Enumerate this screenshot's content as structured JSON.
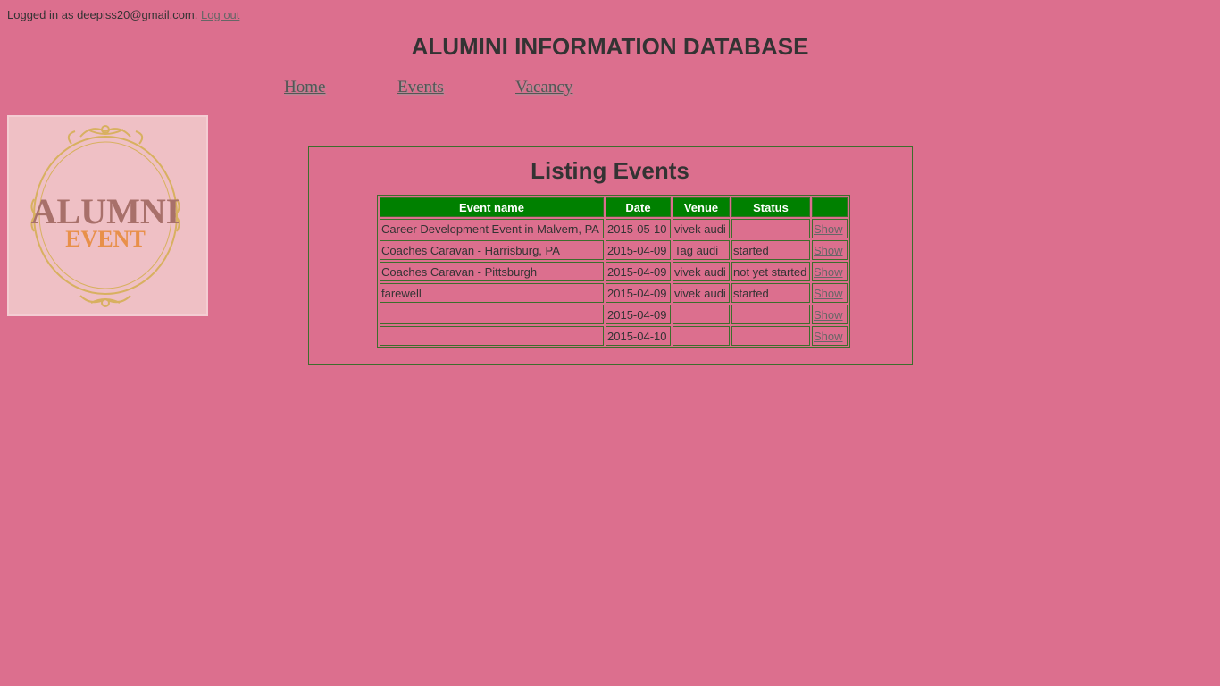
{
  "header": {
    "logged_in_text": "Logged in as deepiss20@gmail.com.",
    "logout_label": "Log out",
    "site_title": "ALUMINI INFORMATION DATABASE"
  },
  "nav": {
    "home": "Home",
    "events": "Events",
    "vacancy": "Vacancy"
  },
  "logo": {
    "line1": "ALUMNI",
    "line2": "EVENT",
    "colors": {
      "line1": "#a8706a",
      "line2": "#e8904a",
      "ornament": "#d8b060"
    }
  },
  "main": {
    "title": "Listing Events",
    "columns": [
      "Event name",
      "Date",
      "Venue",
      "Status",
      ""
    ],
    "rows": [
      {
        "name": "Career Development Event in Malvern, PA",
        "date": "2015-05-10",
        "venue": "vivek audi",
        "status": "",
        "action": "Show"
      },
      {
        "name": "Coaches Caravan - Harrisburg, PA",
        "date": "2015-04-09",
        "venue": "Tag audi",
        "status": "started",
        "action": "Show"
      },
      {
        "name": "Coaches Caravan - Pittsburgh",
        "date": "2015-04-09",
        "venue": "vivek audi",
        "status": "not yet started",
        "action": "Show"
      },
      {
        "name": "farewell",
        "date": "2015-04-09",
        "venue": "vivek audi",
        "status": "started",
        "action": "Show"
      },
      {
        "name": "",
        "date": "2015-04-09",
        "venue": "",
        "status": "",
        "action": "Show"
      },
      {
        "name": "",
        "date": "2015-04-10",
        "venue": "",
        "status": "",
        "action": "Show"
      }
    ]
  },
  "colors": {
    "background": "#dc6f8e",
    "table_header": "#008000",
    "border": "#3c6e2c"
  }
}
